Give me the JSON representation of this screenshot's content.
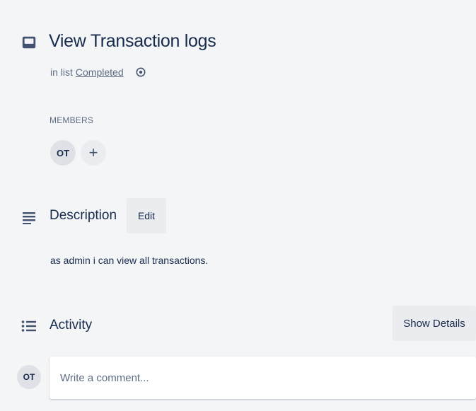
{
  "card": {
    "title": "View Transaction logs",
    "list_prefix": "in list",
    "list_name": "Completed"
  },
  "members": {
    "label": "MEMBERS",
    "items": [
      {
        "initials": "OT"
      }
    ],
    "add_symbol": "+"
  },
  "description": {
    "title": "Description",
    "edit_label": "Edit",
    "text": "as admin i can view all transactions."
  },
  "activity": {
    "title": "Activity",
    "show_details_label": "Show Details",
    "current_user_initials": "OT",
    "comment_placeholder": "Write a comment..."
  },
  "colors": {
    "background": "#f4f5f7",
    "text": "#172b4d",
    "muted": "#5e6c84",
    "button": "#ebecf0",
    "avatar": "#dfe1e6"
  },
  "icons": {
    "card": "card-icon",
    "watch": "eye-icon",
    "description": "description-icon",
    "activity": "activity-icon"
  }
}
